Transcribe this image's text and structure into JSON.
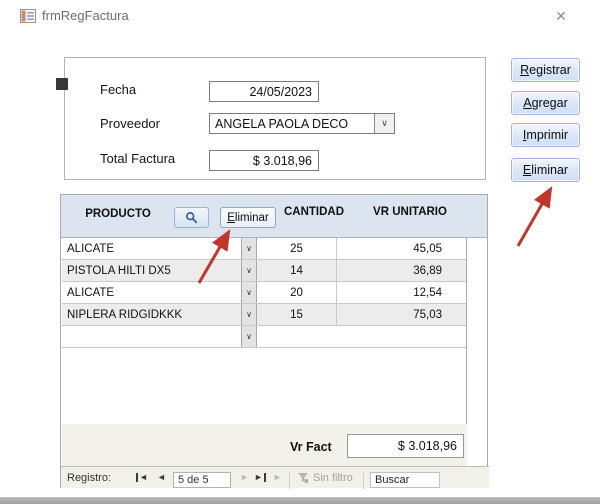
{
  "window": {
    "title": "frmRegFactura",
    "close_glyph": "✕"
  },
  "icons": {
    "chevron_down": "∨",
    "nav_prev": "◄",
    "nav_first": "◄",
    "nav_next": "►",
    "nav_last": "►",
    "nav_new": "►"
  },
  "colors": {
    "band_blue": "#dce4f0",
    "button_face": "#dde8f8",
    "button_border": "#a3b4d6",
    "footer_beige": "#f3f2ea",
    "annotation_arrow_red": "#c2352b",
    "alt_row_gray": "#ececec"
  },
  "form": {
    "fields": {
      "fecha": {
        "label": "Fecha",
        "value": "24/05/2023"
      },
      "proveedor": {
        "label": "Proveedor",
        "value": "ANGELA PAOLA DECO"
      },
      "total": {
        "label": "Total Factura",
        "value": "$ 3.018,96"
      }
    },
    "buttons": {
      "registrar": "Registrar",
      "agregar": "Agregar",
      "imprimir": "Imprimir",
      "eliminar": "Eliminar"
    }
  },
  "subform": {
    "header": {
      "producto": "PRODUCTO",
      "cantidad": "CANTIDAD",
      "vr_unitario": "VR UNITARIO",
      "eliminar_button": "Eliminar"
    },
    "rows": [
      {
        "producto": "ALICATE",
        "cantidad": "25",
        "vr_unitario": "45,05"
      },
      {
        "producto": "PISTOLA HILTI DX5",
        "cantidad": "14",
        "vr_unitario": "36,89"
      },
      {
        "producto": "ALICATE",
        "cantidad": "20",
        "vr_unitario": "12,54"
      },
      {
        "producto": "NIPLERA RIDGIDKKK",
        "cantidad": "15",
        "vr_unitario": "75,03"
      },
      {
        "producto": "",
        "cantidad": "",
        "vr_unitario": ""
      }
    ],
    "footer": {
      "label": "Vr Fact",
      "value": "$ 3.018,96"
    },
    "nav": {
      "label": "Registro:",
      "position": "5 de 5",
      "filter_label": "Sin filtro",
      "search_text": "Buscar"
    }
  }
}
